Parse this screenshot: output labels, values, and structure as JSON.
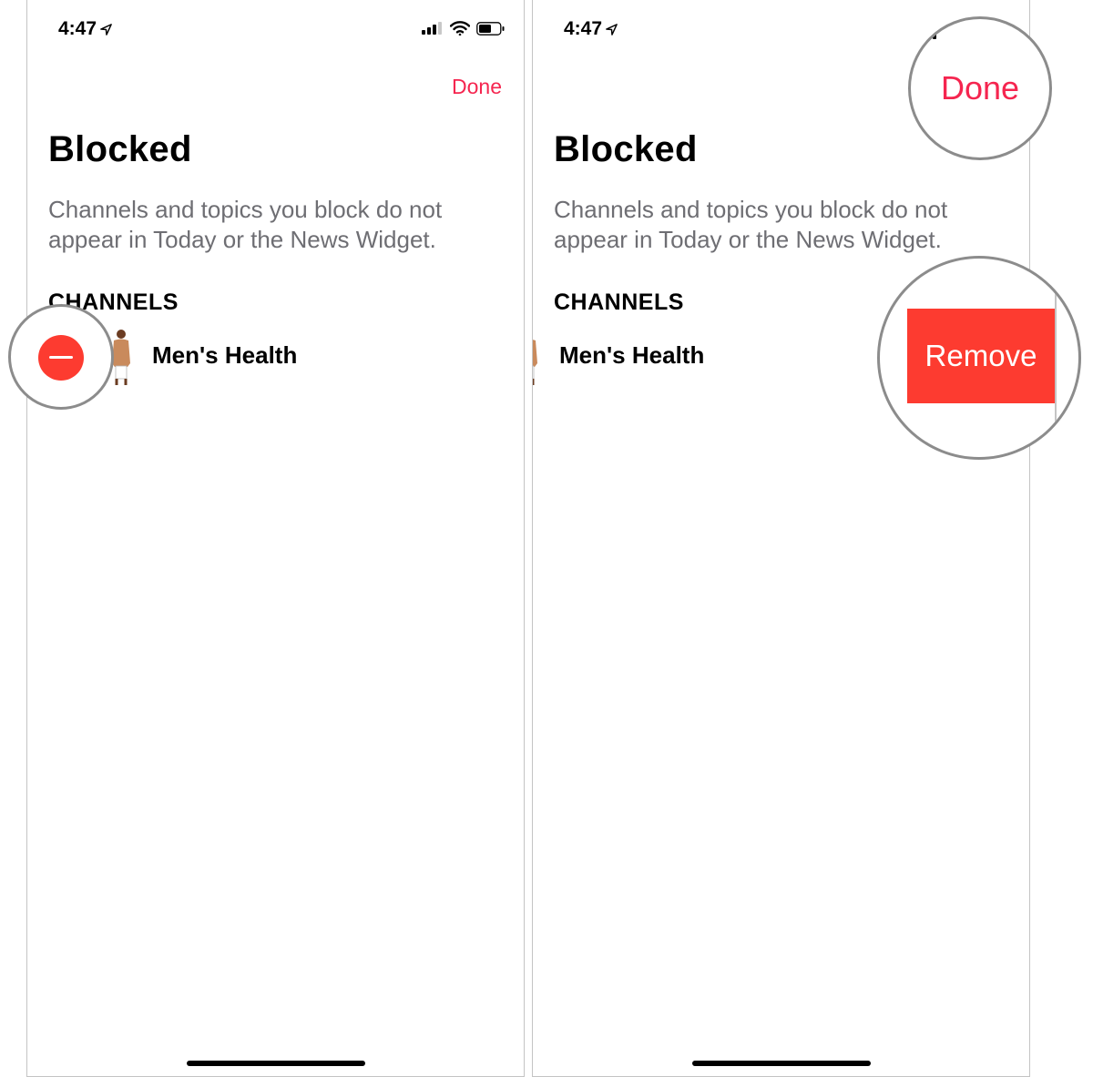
{
  "status": {
    "time": "4:47"
  },
  "nav": {
    "done_label": "Done"
  },
  "page": {
    "title": "Blocked",
    "description": "Channels and topics you block do not appear in Today or the News Widget."
  },
  "section": {
    "label": "CHANNELS"
  },
  "channel": {
    "name": "Men's Health"
  },
  "actions": {
    "remove_label": "Remove"
  },
  "icons": {
    "location": "location-arrow-icon",
    "signal": "cellular-signal-icon",
    "wifi": "wifi-icon",
    "battery": "battery-icon",
    "delete": "minus-circle-icon"
  },
  "colors": {
    "accent": "#f5254f",
    "destructive": "#fd3b30",
    "secondary_text": "#6e6e73"
  }
}
